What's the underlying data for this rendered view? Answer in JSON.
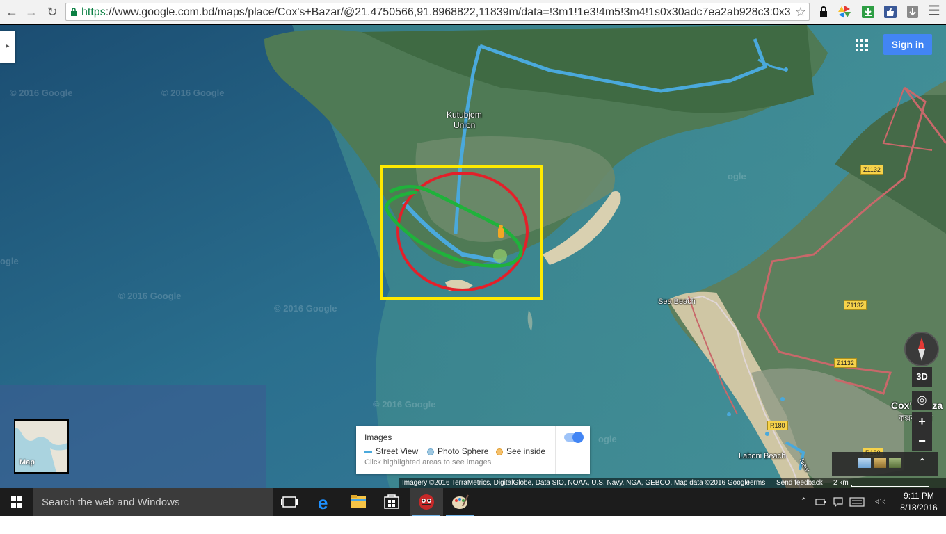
{
  "browser": {
    "url_scheme": "https",
    "url_rest": "://www.google.com.bd/maps/place/Cox's+Bazar/@21.4750566,91.8968822,11839m/data=!3m1!1e3!4m5!3m4!1s0x30adc7ea2ab928c3:0x3b!",
    "icons": [
      "back-arrow-icon",
      "forward-arrow-icon",
      "reload-icon",
      "lock-icon",
      "star-icon"
    ]
  },
  "map": {
    "watermark": "© 2016 Google",
    "watermark_partial": "ogle",
    "labels": {
      "kutubjom_1": "Kutubjom",
      "kutubjom_2": "Union",
      "sea_beach": "Sea Beach",
      "cox_bazar": "Cox's Baza",
      "cox_bazar_bn": "কক্সবাজার",
      "laboni_beach": "Laboni Beach",
      "new": "New"
    },
    "shields": {
      "z1132": "Z1132",
      "r180": "R180"
    },
    "sign_in": "Sign in",
    "minimap_label": "Map",
    "images_panel": {
      "title": "Images",
      "street_view": "Street View",
      "photo_sphere": "Photo Sphere",
      "see_inside": "See inside",
      "hint": "Click highlighted areas to see images"
    },
    "controls": {
      "three_d": "3D",
      "zoom_in": "+",
      "zoom_out": "−",
      "expand": "⌃"
    },
    "attribution": {
      "text": "Imagery ©2016 TerraMetrics, DigitalGlobe, Data SIO, NOAA, U.S. Navy, NGA, GEBCO, Map data ©2016 Google",
      "terms": "Terms",
      "feedback": "Send feedback",
      "scale": "2 km"
    },
    "colors": {
      "annotation_rect": "#ffea00",
      "annotation_circle": "#e3202a",
      "annotation_outline": "#1fb23b",
      "street_view": "#4aa9dc",
      "road": "#c8686a"
    }
  },
  "taskbar": {
    "search_placeholder": "Search the web and Windows",
    "language": "বাং",
    "time": "9:11 PM",
    "date": "8/18/2016",
    "icons": [
      "windows-logo-icon",
      "task-view-icon",
      "edge-icon",
      "file-explorer-icon",
      "store-icon",
      "app-bird-icon",
      "paint-icon"
    ]
  }
}
